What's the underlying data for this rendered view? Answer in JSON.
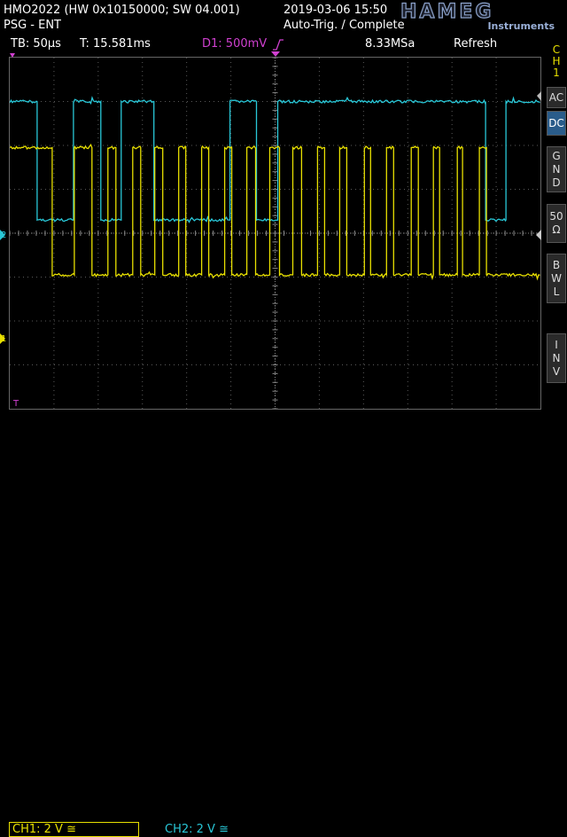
{
  "header": {
    "device": "HMO2022 (HW 0x10150000; SW 04.001)",
    "mode": "PSG - ENT",
    "datetime": "2019-03-06 15:50",
    "trigger_status": "Auto-Trig. / Complete",
    "brand": "HAMEG",
    "brand_sub": "Instruments",
    "timebase": "TB: 50µs",
    "time_offset": "T: 15.581ms",
    "trigger_level": "D1: 500mV",
    "trigger_edge_icon": "rising-edge-icon",
    "sample_rate": "8.33MSa",
    "acquire_mode": "Refresh"
  },
  "sidebar": {
    "channel": [
      "C",
      "H",
      "1"
    ],
    "buttons": [
      {
        "id": "ac",
        "lines": [
          "AC"
        ],
        "active": false
      },
      {
        "id": "dc",
        "lines": [
          "DC"
        ],
        "active": true
      },
      {
        "id": "gnd",
        "lines": [
          "G",
          "N",
          "D"
        ],
        "active": false
      },
      {
        "id": "50ohm",
        "lines": [
          "50",
          "Ω"
        ],
        "active": false
      },
      {
        "id": "bwl",
        "lines": [
          "B",
          "W",
          "L"
        ],
        "active": false
      },
      {
        "id": "inv",
        "lines": [
          "I",
          "N",
          "V"
        ],
        "active": false
      }
    ]
  },
  "footer": {
    "ch1": "CH1: 2 V ≅",
    "ch2": "CH2: 2 V ≅"
  },
  "markers": {
    "ch2_ref": "2",
    "ch1_ref": "1",
    "trigger_time": "T"
  },
  "colors": {
    "ch1": "#e8e000",
    "ch2": "#29c8d8",
    "trigger": "#d040d0",
    "grid": "#5a5a5a",
    "accent": "#2a5c8a"
  },
  "waveforms": {
    "ch2": {
      "high_level_div": 3.0,
      "low_level_div": 0.3,
      "transitions_div": [
        0.31,
        0.72,
        1.03,
        1.26,
        1.63,
        2.49,
        2.79,
        3.03,
        5.38,
        5.61
      ],
      "starts_high": true
    },
    "ch1": {
      "high_level_div": 1.95,
      "low_level_div": -0.95,
      "transitions_div": [
        0.48,
        0.73,
        0.93,
        1.11,
        1.2,
        1.39,
        1.48,
        1.64,
        1.73,
        1.91,
        1.99,
        2.17,
        2.25,
        2.43,
        2.51,
        2.68,
        2.78,
        2.94,
        3.05,
        3.2,
        3.3,
        3.48,
        3.56,
        3.73,
        3.81,
        4.01,
        4.08,
        4.26,
        4.34,
        4.54,
        4.62,
        4.79,
        4.86,
        5.06,
        5.12,
        5.31,
        5.39
      ],
      "starts_high": true
    }
  }
}
